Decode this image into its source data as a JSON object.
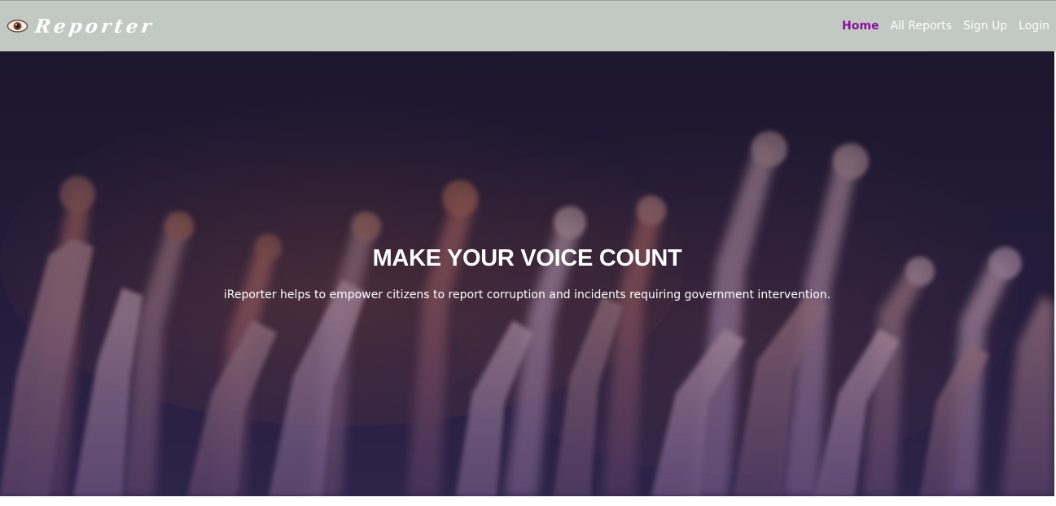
{
  "navbar": {
    "brand_icon": "eye-icon",
    "brand_text": "Reporter",
    "links": [
      {
        "label": "Home",
        "active": true
      },
      {
        "label": "All Reports",
        "active": false
      },
      {
        "label": "Sign Up",
        "active": false
      },
      {
        "label": "Login",
        "active": false
      }
    ],
    "colors": {
      "background": "#c1c9c2",
      "active_link": "#8b0c9c",
      "link": "#ffffff"
    }
  },
  "hero": {
    "title": "MAKE YOUR VOICE COUNT",
    "subtitle": "iReporter helps to empower citizens to report corruption and incidents requiring government intervention.",
    "overlay_color": "#2d2350"
  }
}
